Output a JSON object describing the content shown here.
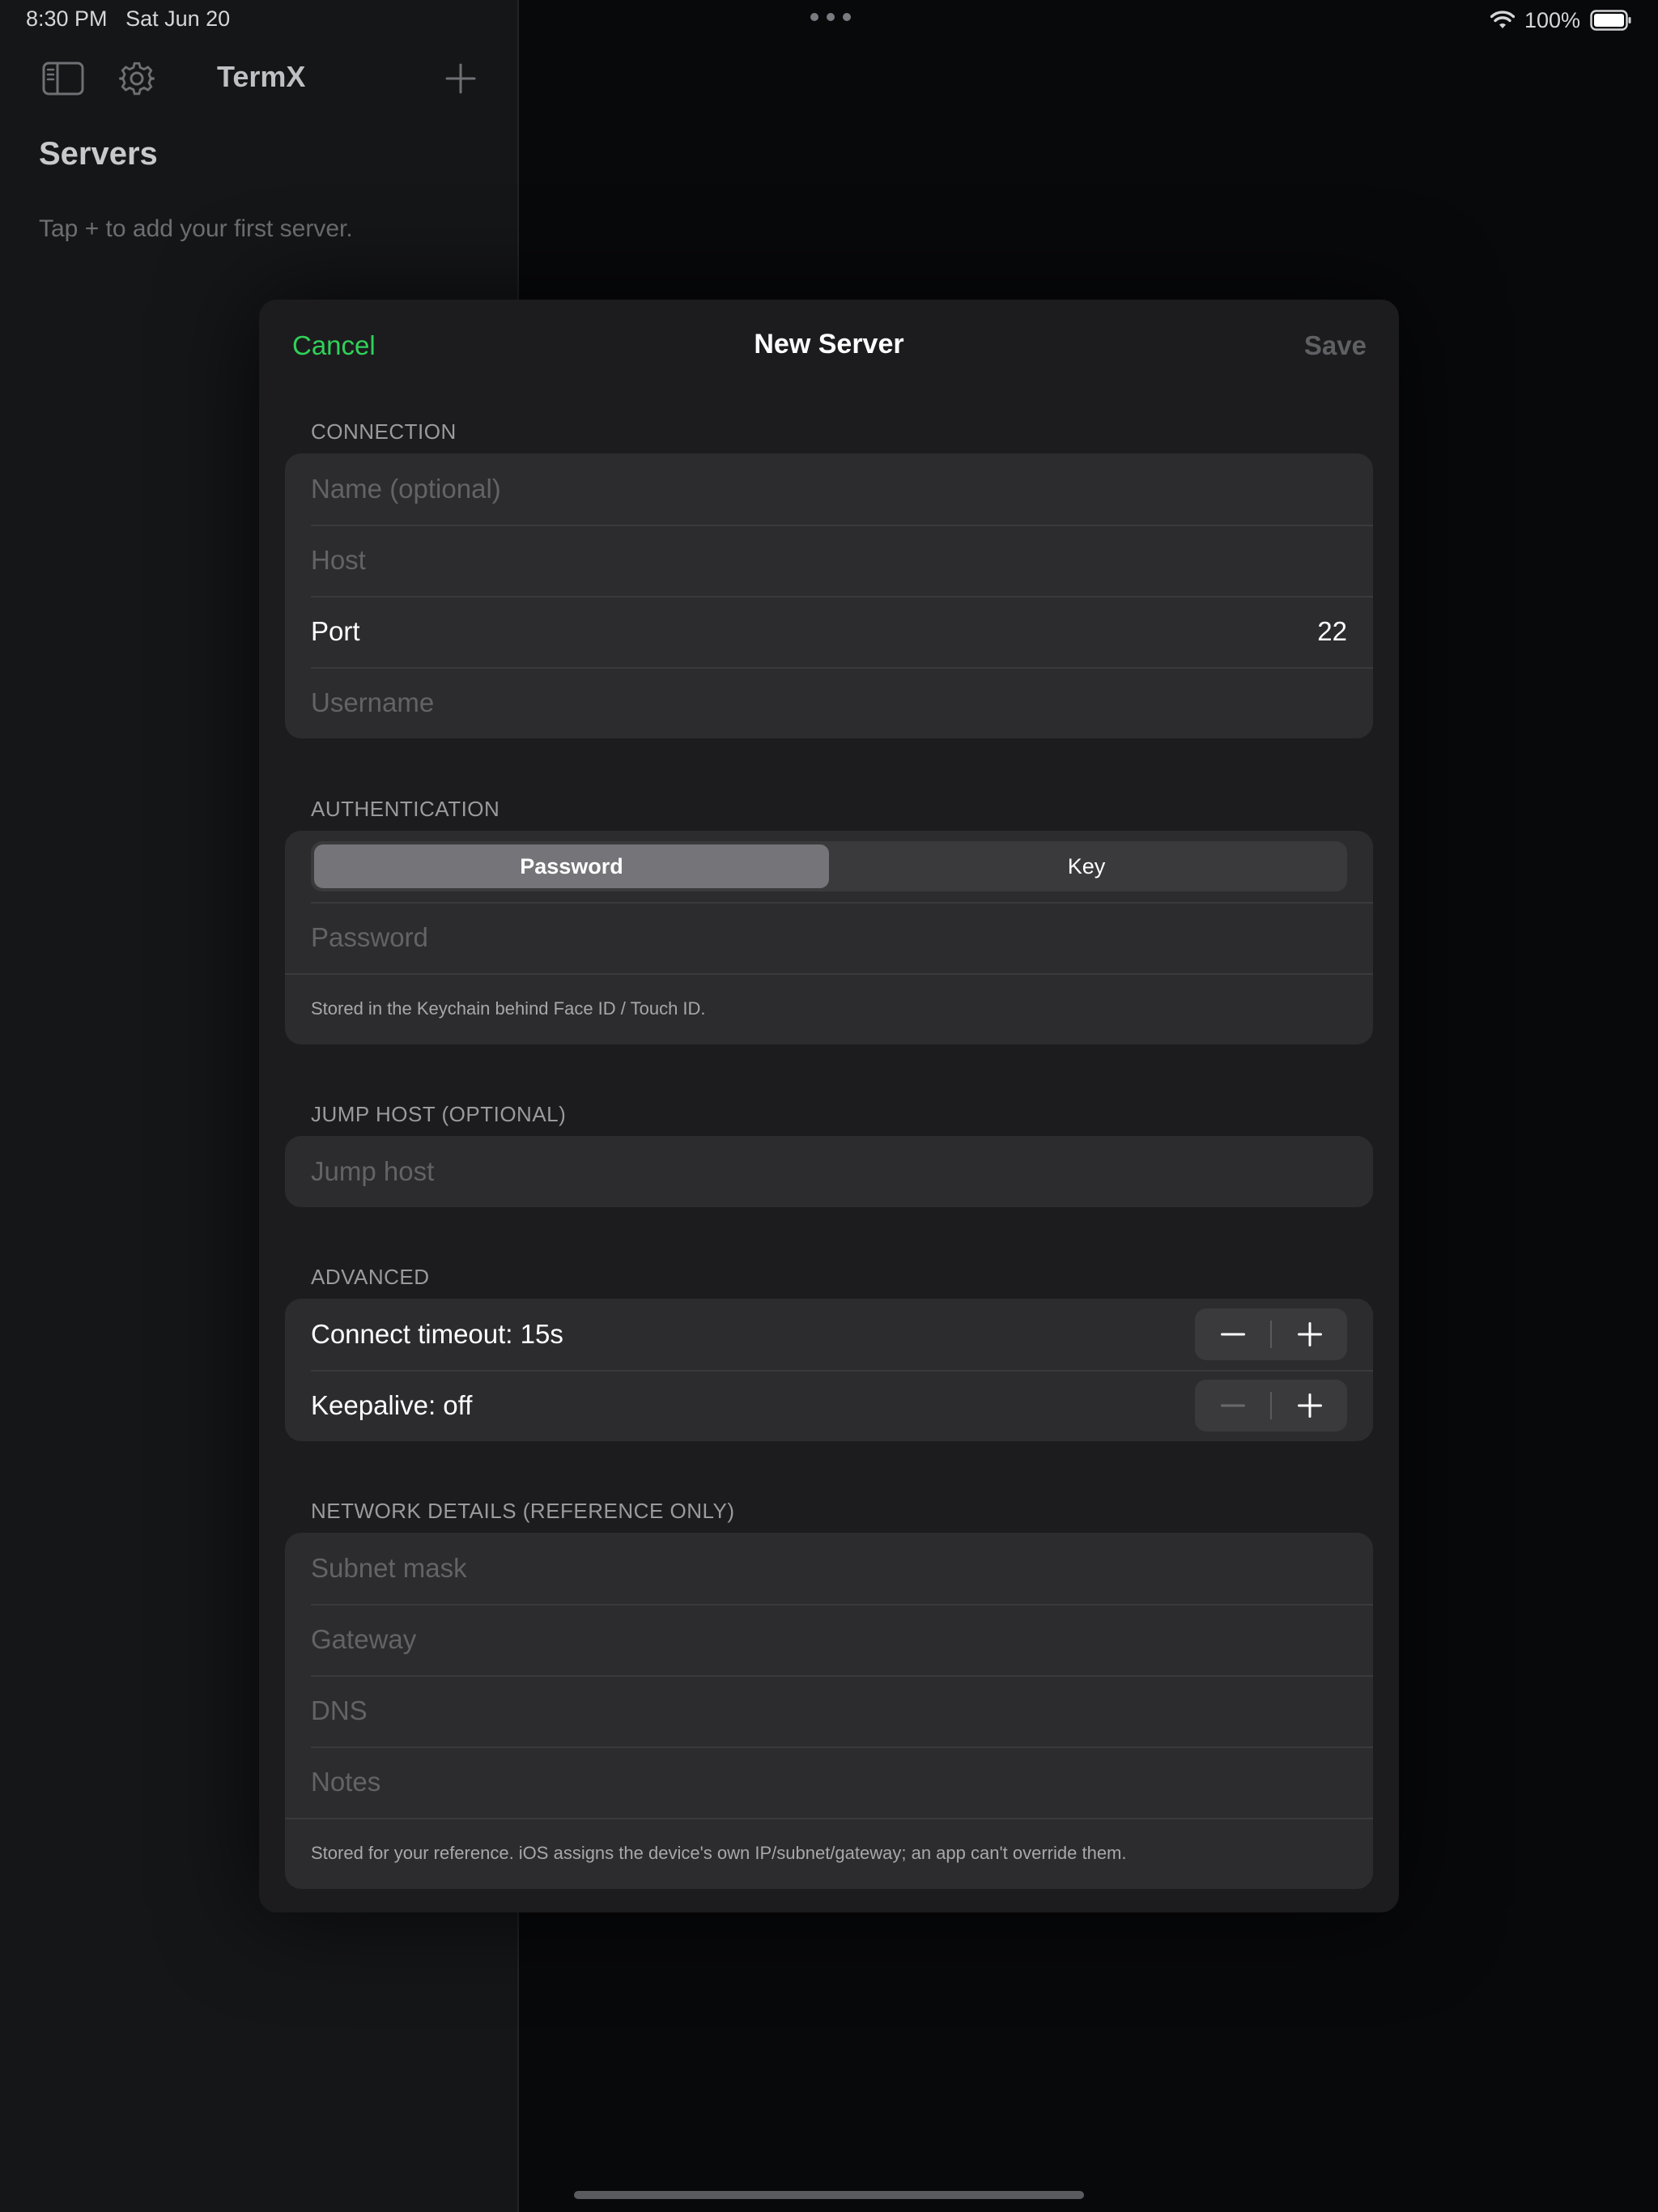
{
  "status_bar": {
    "time": "8:30 PM",
    "date": "Sat Jun 20",
    "battery": "100%"
  },
  "sidebar": {
    "app_title": "TermX",
    "section_title": "Servers",
    "empty_hint": "Tap + to add your first server.",
    "icons": [
      "sidebar-toggle-icon",
      "gear-icon",
      "plus-icon"
    ]
  },
  "sheet": {
    "cancel_label": "Cancel",
    "title": "New Server",
    "save_label": "Save",
    "connection": {
      "header": "CONNECTION",
      "name_placeholder": "Name (optional)",
      "host_placeholder": "Host",
      "port_label": "Port",
      "port_value": "22",
      "username_placeholder": "Username"
    },
    "authentication": {
      "header": "AUTHENTICATION",
      "segments": [
        "Password",
        "Key"
      ],
      "selected_segment": "Password",
      "password_placeholder": "Password",
      "footnote": "Stored in the Keychain behind Face ID / Touch ID."
    },
    "jump_host": {
      "header": "JUMP HOST (OPTIONAL)",
      "placeholder": "Jump host"
    },
    "advanced": {
      "header": "ADVANCED",
      "connect_timeout": "Connect timeout: 15s",
      "keepalive": "Keepalive: off"
    },
    "network": {
      "header": "NETWORK DETAILS (REFERENCE ONLY)",
      "subnet_placeholder": "Subnet mask",
      "gateway_placeholder": "Gateway",
      "dns_placeholder": "DNS",
      "notes_placeholder": "Notes",
      "footnote": "Stored for your reference. iOS assigns the device's own IP/subnet/gateway; an app can't override them."
    }
  },
  "colors": {
    "accent": "#30d158",
    "sheet_bg": "#1c1c1e",
    "group_bg": "#2c2c2e"
  }
}
